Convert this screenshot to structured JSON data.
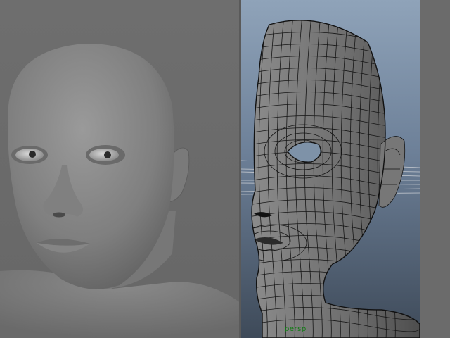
{
  "render_view": {
    "background": "#6b6b6b"
  },
  "viewport": {
    "camera_label": "persp",
    "background_top": "#8fa3b9",
    "background_bottom": "#3e4a59",
    "wire_color": "#151515",
    "label_color": "#0f7a12"
  }
}
